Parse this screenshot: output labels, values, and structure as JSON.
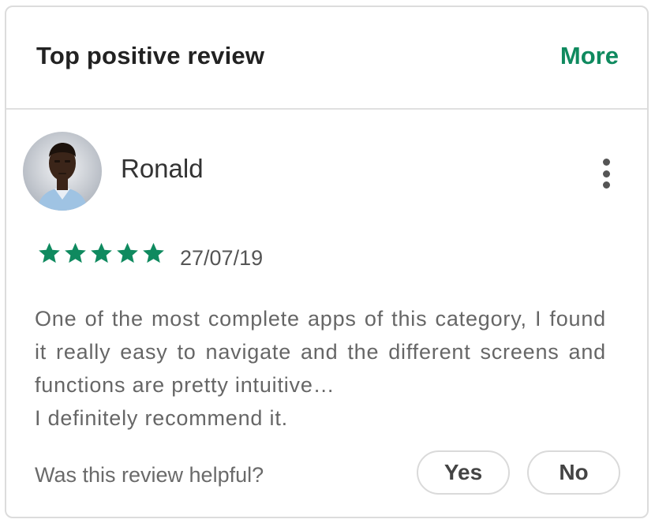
{
  "header": {
    "title": "Top positive review",
    "more_label": "More"
  },
  "reviewer": {
    "name": "Ronald",
    "avatar": "avatar-photo"
  },
  "review": {
    "rating": 5,
    "max_rating": 5,
    "date": "27/07/19",
    "text_lines": [
      "One of the most complete apps of this category, I found it really easy to navigate and the different screens and functions are pretty intuitive…",
      "I definitely recommend it."
    ]
  },
  "feedback": {
    "question": "Was this review helpful?",
    "yes_label": "Yes",
    "no_label": "No"
  },
  "colors": {
    "accent": "#0f8a5f",
    "star": "#0f8a5f"
  },
  "icons": {
    "menu": "more-vert-icon",
    "star": "star-icon"
  }
}
